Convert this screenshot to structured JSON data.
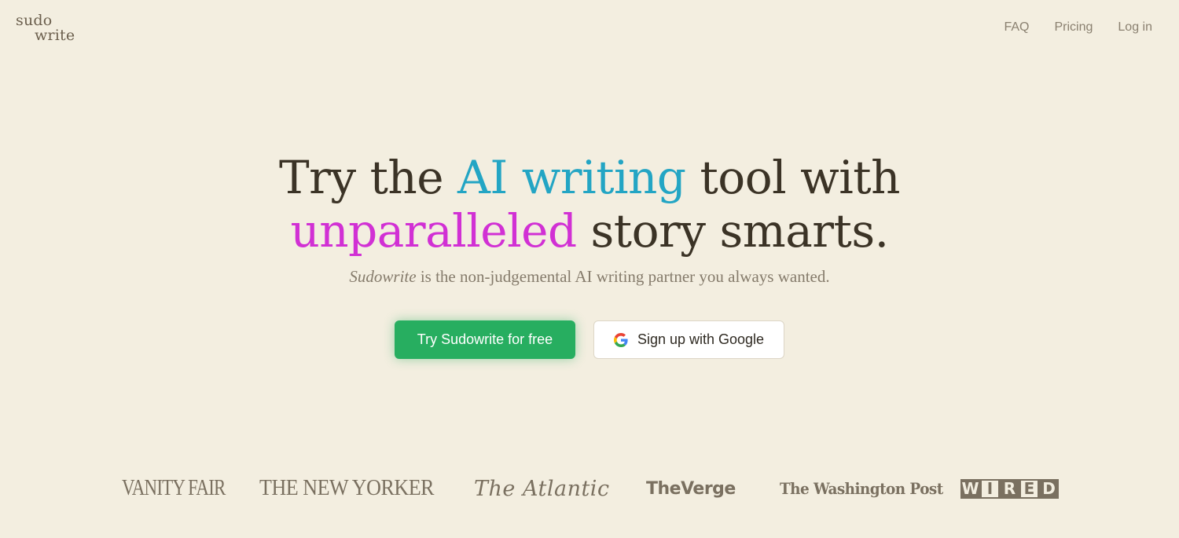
{
  "brand": {
    "logo_line1": "sudo",
    "logo_line2": "write"
  },
  "nav": {
    "items": [
      {
        "label": "FAQ"
      },
      {
        "label": "Pricing"
      },
      {
        "label": "Log in"
      }
    ]
  },
  "hero": {
    "headline_part1": "Try the ",
    "headline_highlight1": "AI writing",
    "headline_part2": " tool with",
    "headline_highlight2": "unparalleled",
    "headline_part3": " story smarts.",
    "sub_brand": "Sudowrite",
    "sub_text": " is the non-judgemental AI writing partner you always wanted."
  },
  "cta": {
    "primary_label": "Try Sudowrite for free",
    "google_label": "Sign up with Google"
  },
  "press": {
    "logos": [
      "VANITY FAIR",
      "THE NEW YORKER",
      "The Atlantic",
      "TheVerge",
      "The Washington Post",
      "WIRED"
    ],
    "wired_letters": [
      "W",
      "I",
      "R",
      "E",
      "D"
    ]
  },
  "colors": {
    "background": "#f3eee0",
    "headline": "#3b3326",
    "highlight_ai": "#23a5c4",
    "highlight_unparalleled": "#d130d4",
    "primary_button": "#27ae60"
  }
}
